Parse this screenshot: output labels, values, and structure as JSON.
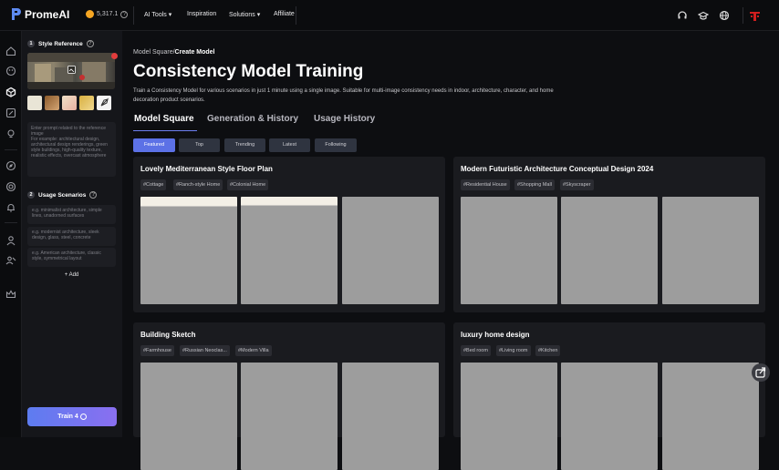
{
  "app": {
    "name": "PromeAI"
  },
  "topbar": {
    "credits": "5,317.1",
    "nav": [
      "AI Tools",
      "Inspiration",
      "Solutions",
      "Affiliate"
    ]
  },
  "sidebar": {
    "style_reference": {
      "number": "1",
      "title": "Style Reference"
    },
    "prompt_placeholder": "Enter prompt related to the reference image\nFor example: architectural design, architectural design renderings, green style buildings, high-quality texture, realistic effects, overcast atmosphere",
    "usage": {
      "number": "2",
      "title": "Usage Scenarios"
    },
    "scenarios": [
      "e.g. minimalist architecture, simple lines, unadorned surfaces",
      "e.g. modernist architecture, sleek design, glass, steel, concrete",
      "e.g. American architecture, classic style, symmetrical layout"
    ],
    "add_label": "Add",
    "train_label": "Train 4"
  },
  "main": {
    "breadcrumb": {
      "parent": "Model Square",
      "sep": "/",
      "current": "Create Model"
    },
    "title": "Consistency Model Training",
    "description": "Train a Consistency Model for various scenarios in just 1 minute using a single image. Suitable for multi-image consistency needs in indoor, architecture, character, and home decoration product scenarios.",
    "tabs": [
      "Model Square",
      "Generation & History",
      "Usage History"
    ],
    "filters": [
      "Featured",
      "Top",
      "Trending",
      "Latest",
      "Following"
    ],
    "cards": [
      {
        "title": "Lovely Mediterranean Style Floor Plan",
        "tags": [
          "#Cottage",
          "#Ranch-style Home",
          "#Colonial Home"
        ]
      },
      {
        "title": "Modern Futuristic Architecture Conceptual Design 2024",
        "tags": [
          "#Residential House",
          "#Shopping Mall",
          "#Skyscraper"
        ]
      },
      {
        "title": "Building Sketch",
        "tags": [
          "#Farmhouse",
          "#Russian Neoclas...",
          "#Modern Villa"
        ]
      },
      {
        "title": "luxury home design",
        "tags": [
          "#Bed room",
          "#Living room",
          "#Kitchen"
        ]
      }
    ]
  },
  "colors": {
    "accent": "#5c71e6",
    "background": "#0d0e11",
    "panel": "#15161a",
    "card": "#1a1b1f",
    "placeholder": "#9d9d9d"
  }
}
